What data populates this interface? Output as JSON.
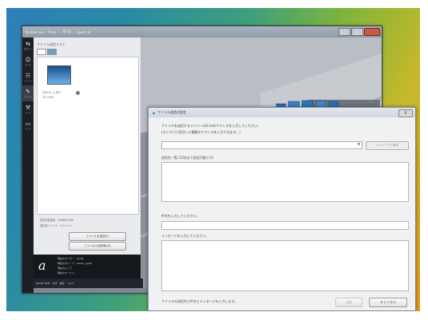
{
  "main_window": {
    "title": "Brother ew - ",
    "breadcrumbs": [
      "Think",
      "第1会",
      "guest_m"
    ],
    "sidebar": [
      "ログイン",
      "ユーザ",
      "メンバー",
      "ファイル",
      "ツール",
      "ゲーム"
    ],
    "panel_label": "ファイル送信リスト",
    "file": {
      "name": "DSC01_1.JPG",
      "size": "75.4 KB"
    },
    "stats": [
      {
        "label": "送信可能容量",
        "value": "10MB/0.0KB"
      },
      {
        "label": "送信済ファイル",
        "value": "0ファイル"
      }
    ],
    "buttons": {
      "add": "ファイルを追加(F)",
      "clear": "ファイルの全削除(D)"
    },
    "user": {
      "lines": [
        "現在のユーザー : Guest",
        "現在のグループ : Admin_guest",
        "現在のエリア",
        "現在のワールド"
      ],
      "logo": "a"
    },
    "taskbar": [
      "ROOM TIME",
      "文字",
      "設定",
      "ヘルプ"
    ]
  },
  "dialog": {
    "title": "ファイル送信の設定",
    "close": "X",
    "instruction_1": "ファイルを送信するメンバーのE-mailアドレスを入力してください。",
    "instruction_2": "(カンマ(,)で区切って複数のアドレスを入力できます。)",
    "member_button": "メンバーから選択",
    "recipients_label": "送信先一覧 (15名まで送信可能です)",
    "subject_label": "件名を入力してください。",
    "message_label": "メッセージを入力してください。",
    "footer_text": "ファイルの送信先と件名とメッセージを入力します。",
    "send_button": "送信",
    "cancel_button": "キャンセル"
  }
}
